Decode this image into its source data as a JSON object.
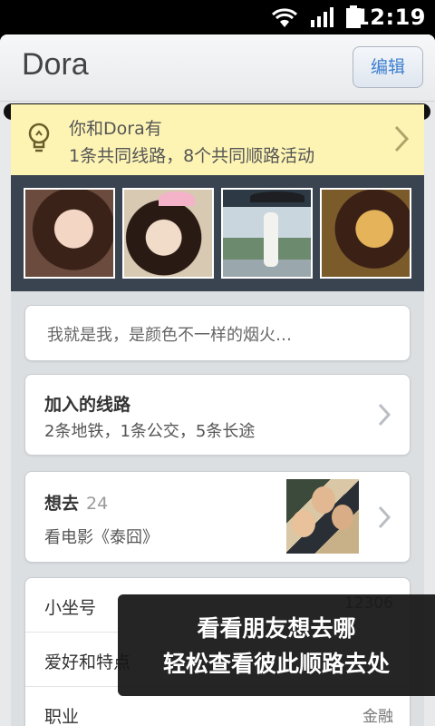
{
  "status_bar": {
    "time": "12:19",
    "icons": [
      "wifi-icon",
      "signal-icon",
      "battery-icon"
    ]
  },
  "header": {
    "title": "Dora",
    "edit_label": "编辑"
  },
  "banner": {
    "line1": "你和Dora有",
    "line2": "1条共同线路，8个共同顺路活动",
    "icon": "lightbulb-icon",
    "background": "#fdf4b4"
  },
  "photos": [
    "photo-1",
    "photo-2",
    "photo-3",
    "photo-4"
  ],
  "bio": "我就是我，是颜色不一样的烟火…",
  "routes": {
    "title": "加入的线路",
    "summary": "2条地铁，1条公交，5条长途"
  },
  "want_to_go": {
    "title": "想去",
    "count": "24",
    "item": "看电影《泰囧》"
  },
  "profile_info": [
    {
      "label": "小坐号",
      "value": "12306"
    },
    {
      "label": "爱好和特点",
      "value": ""
    },
    {
      "label": "职业",
      "value": "金融"
    }
  ],
  "toast": {
    "line1": "看看朋友想去哪",
    "line2": "轻松查看彼此顺路去处"
  },
  "colors": {
    "accent": "#3d7fcf",
    "photo_strip": "#3a4450"
  }
}
